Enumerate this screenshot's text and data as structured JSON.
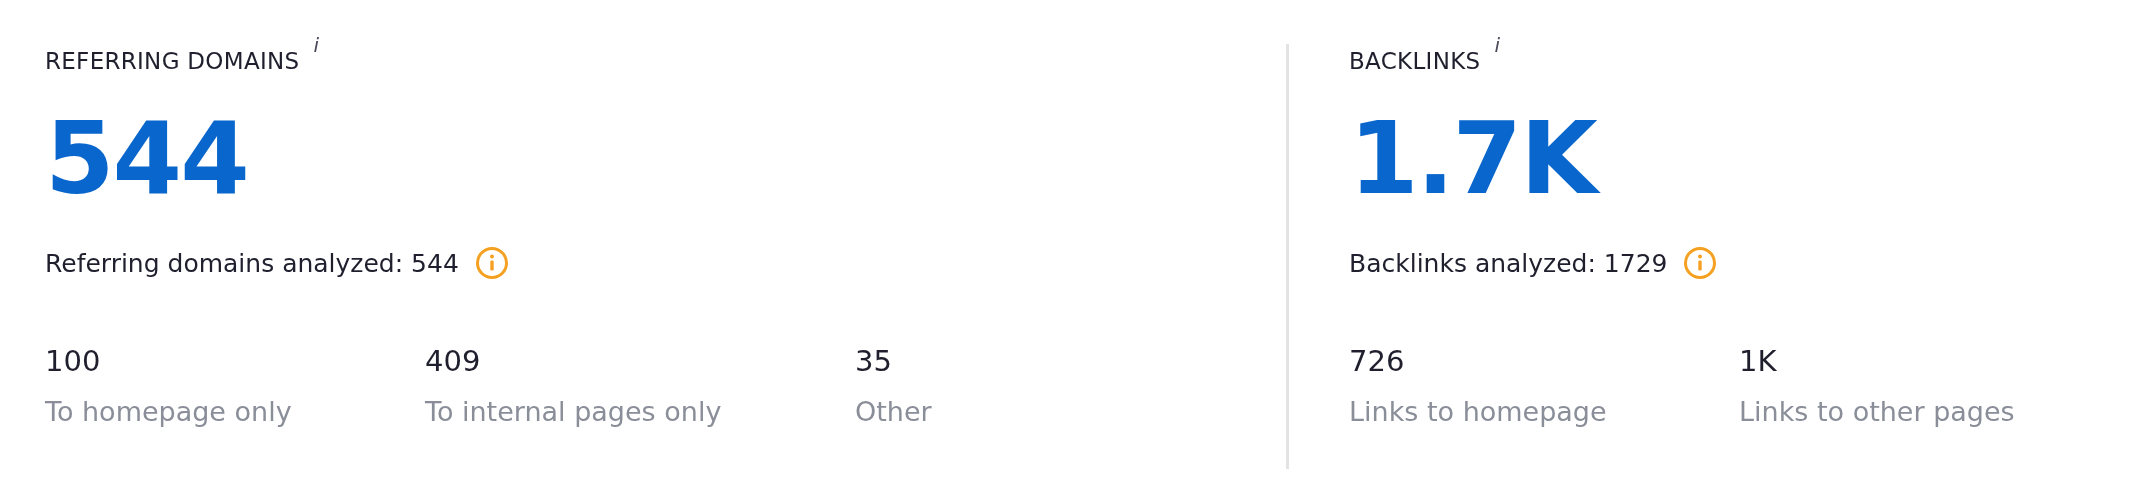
{
  "panels": [
    {
      "title": "REFERRING DOMAINS",
      "title_mark": "i",
      "value": "544",
      "analyzed": "Referring domains analyzed: 544",
      "stats": [
        {
          "value": "100",
          "label": "To homepage only"
        },
        {
          "value": "409",
          "label": "To internal pages only"
        },
        {
          "value": "35",
          "label": "Other"
        }
      ]
    },
    {
      "title": "BACKLINKS",
      "title_mark": "i",
      "value": "1.7K",
      "analyzed": "Backlinks analyzed: 1729",
      "stats": [
        {
          "value": "726",
          "label": "Links to homepage"
        },
        {
          "value": "1K",
          "label": "Links to other pages"
        }
      ]
    }
  ]
}
